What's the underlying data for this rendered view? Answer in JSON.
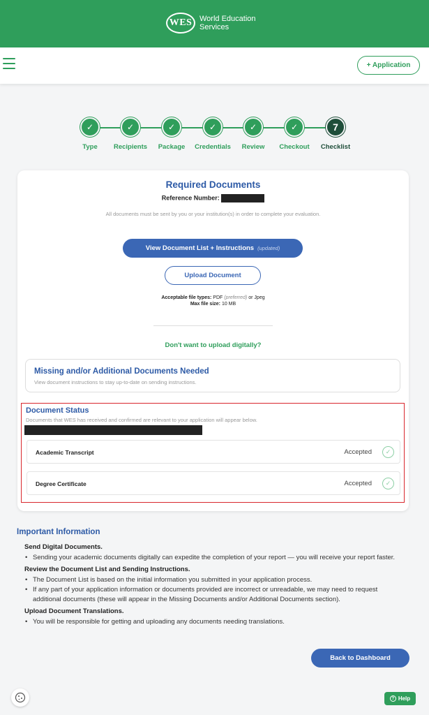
{
  "header": {
    "logo_mark": "WES",
    "logo_line1": "World Education",
    "logo_line2": "Services"
  },
  "nav": {
    "menu_icon": "hamburger-menu-icon",
    "application_button": "+ Application"
  },
  "stepper": {
    "steps": [
      {
        "label": "Type",
        "marker": "✓"
      },
      {
        "label": "Recipients",
        "marker": "✓"
      },
      {
        "label": "Package",
        "marker": "✓"
      },
      {
        "label": "Credentials",
        "marker": "✓"
      },
      {
        "label": "Review",
        "marker": "✓"
      },
      {
        "label": "Checkout",
        "marker": "✓"
      },
      {
        "label": "Checklist",
        "marker": "7"
      }
    ],
    "active_step": 7
  },
  "required": {
    "title": "Required Documents",
    "reference_label": "Reference Number:",
    "intro": "All documents must be sent by you or your institution(s) in order to complete your evaluation.",
    "view_button": "View Document List + Instructions",
    "view_button_tag": "(updated)",
    "upload_button": "Upload Document",
    "file_types_label": "Acceptable file types:",
    "file_type_pdf": "PDF",
    "file_type_pref": "(preferred)",
    "file_type_or": "or Jpeg",
    "max_size_label": "Max file size:",
    "max_size_value": "10 MB",
    "dont_upload": "Don't want to upload digitally?"
  },
  "missing": {
    "title": "Missing and/or Additional Documents Needed",
    "subtitle": "View document instructions to stay up-to-date on sending instructions."
  },
  "status": {
    "title": "Document Status",
    "subtitle": "Documents that WES has received and confirmed are relevant to your application will appear below.",
    "documents": [
      {
        "name": "Academic Transcript",
        "status": "Accepted"
      },
      {
        "name": "Degree Certificate",
        "status": "Accepted"
      }
    ]
  },
  "info": {
    "title": "Important Information",
    "sections": [
      {
        "heading": "Send Digital Documents.",
        "items": [
          "Sending your academic documents digitally can expedite the completion of your report — you will receive your report faster."
        ]
      },
      {
        "heading": "Review the Document List and Sending Instructions.",
        "items": [
          "The Document List is based on the initial information you submitted in your application process.",
          "If any part of your application information or documents provided are incorrect or unreadable, we may need to request additional documents (these will appear in the Missing Documents and/or Additional Documents section)."
        ]
      },
      {
        "heading": "Upload Document Translations.",
        "items": [
          "You will be responsible for getting and uploading any documents needing translations."
        ]
      }
    ]
  },
  "footer": {
    "dashboard_button": "Back to Dashboard",
    "help_button": "Help",
    "cookie_icon": "cookie-icon"
  },
  "colors": {
    "brand_green": "#2f9e5b",
    "brand_blue": "#3b67b5",
    "highlight_red": "#d9262c"
  }
}
